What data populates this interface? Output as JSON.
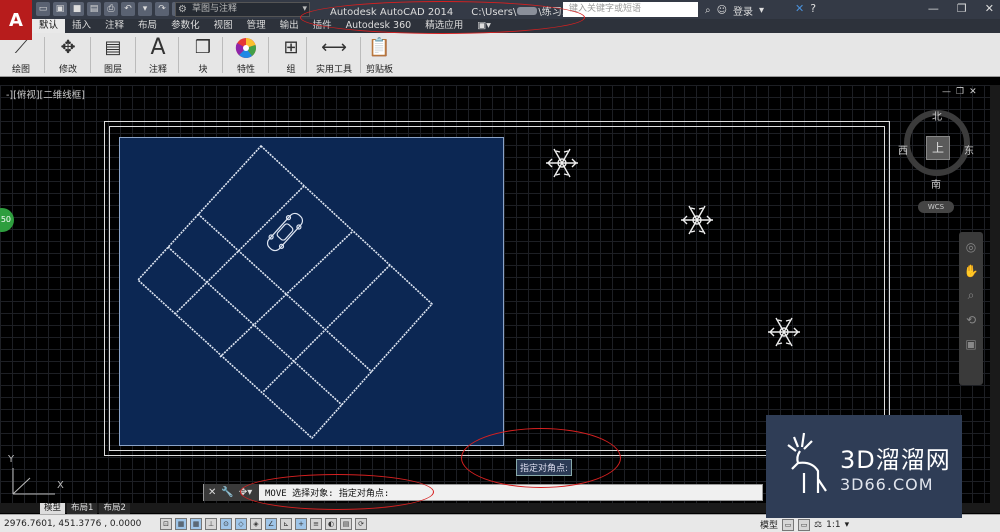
{
  "titlebar": {
    "logo": "A",
    "workspace": "草图与注释",
    "app_title": "Autodesk AutoCAD 2014",
    "file_path": "C:\\Users\\",
    "file_name": "\\练习.dwg",
    "search_placeholder": "键入关键字或短语",
    "login_label": "登录"
  },
  "ribbon_tabs": [
    "默认",
    "插入",
    "注释",
    "布局",
    "参数化",
    "视图",
    "管理",
    "输出",
    "插件",
    "Autodesk 360",
    "精选应用"
  ],
  "ribbon_panels": {
    "draw": "绘图",
    "modify": "修改",
    "layer": "图层",
    "annotate": "注释",
    "block": "块",
    "properties": "特性",
    "group": "组",
    "utilities": "实用工具",
    "clipboard": "剪贴板"
  },
  "viewport_label": "-][俯视][二维线框]",
  "left_badge": "50",
  "viewcube": {
    "top": "上",
    "north": "北",
    "south": "南",
    "east": "东",
    "west": "西",
    "wcs": "WCS"
  },
  "ucs": {
    "x": "X",
    "y": "Y"
  },
  "tooltip": "指定对角点:",
  "command_line": "MOVE 选择对象: 指定对角点:",
  "layout_tabs": [
    "模型",
    "布局1",
    "布局2"
  ],
  "status": {
    "coords": "2976.7601, 451.3776 , 0.0000",
    "model_label": "模型",
    "scale": "1:1"
  },
  "watermark": {
    "cn": "3D溜溜网",
    "en": "3D66.COM"
  },
  "colors": {
    "annotation_red": "#d62020",
    "viewport_blue": "#0c2753",
    "autocad_red": "#b71c1c"
  }
}
